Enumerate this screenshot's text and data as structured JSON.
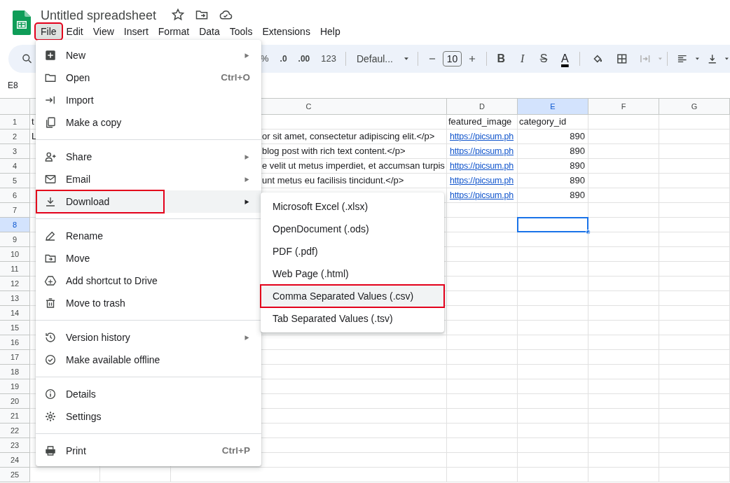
{
  "app": {
    "title": "Untitled spreadsheet"
  },
  "menubar": [
    {
      "label": "File",
      "selected": true,
      "annotated": true
    },
    {
      "label": "Edit",
      "selected": false,
      "annotated": false
    },
    {
      "label": "View",
      "selected": false,
      "annotated": false
    },
    {
      "label": "Insert",
      "selected": false,
      "annotated": false
    },
    {
      "label": "Format",
      "selected": false,
      "annotated": false
    },
    {
      "label": "Data",
      "selected": false,
      "annotated": false
    },
    {
      "label": "Tools",
      "selected": false,
      "annotated": false
    },
    {
      "label": "Extensions",
      "selected": false,
      "annotated": false
    },
    {
      "label": "Help",
      "selected": false,
      "annotated": false
    }
  ],
  "toolbar": {
    "number_formats": [
      "%",
      ".0",
      ".00",
      "123"
    ],
    "font": "Defaul...",
    "font_size": "10",
    "text_styles": [
      {
        "label": "B",
        "kind": "bold"
      },
      {
        "label": "I",
        "kind": "italic"
      },
      {
        "label": "S",
        "kind": "strike"
      },
      {
        "label": "A",
        "kind": "color"
      }
    ]
  },
  "name_box": "E8",
  "columns": [
    {
      "label": "C",
      "selected": false
    },
    {
      "label": "D",
      "selected": false
    },
    {
      "label": "E",
      "selected": true
    },
    {
      "label": "F",
      "selected": false
    },
    {
      "label": "G",
      "selected": false
    }
  ],
  "rows": [
    {
      "number": "1",
      "selected": false,
      "a": {
        "text": "t"
      },
      "d": {
        "text": "featured_image"
      },
      "e": {
        "text": "category_id"
      }
    },
    {
      "number": "2",
      "selected": false,
      "a": {
        "text": "L"
      },
      "c": {
        "text": "or sit amet, consectetur adipiscing elit.</p>"
      },
      "d": {
        "text": "https://picsum.ph",
        "kind": "link"
      },
      "e": {
        "text": "890",
        "kind": "number"
      }
    },
    {
      "number": "3",
      "selected": false,
      "c": {
        "text": "blog post with rich text content.</p>"
      },
      "d": {
        "text": "https://picsum.ph",
        "kind": "link"
      },
      "e": {
        "text": "890",
        "kind": "number"
      }
    },
    {
      "number": "4",
      "selected": false,
      "c": {
        "text": "e velit ut metus imperdiet, et accumsan turpis"
      },
      "d": {
        "text": "https://picsum.ph",
        "kind": "link"
      },
      "e": {
        "text": "890",
        "kind": "number"
      }
    },
    {
      "number": "5",
      "selected": false,
      "c": {
        "text": "unt metus eu facilisis tincidunt.</p>"
      },
      "d": {
        "text": "https://picsum.ph",
        "kind": "link"
      },
      "e": {
        "text": "890",
        "kind": "number"
      }
    },
    {
      "number": "6",
      "selected": false,
      "d": {
        "text": "https://picsum.ph",
        "kind": "link"
      },
      "e": {
        "text": "890",
        "kind": "number"
      }
    },
    {
      "number": "7",
      "selected": false
    },
    {
      "number": "8",
      "selected": true
    },
    {
      "number": "9",
      "selected": false
    },
    {
      "number": "10",
      "selected": false
    },
    {
      "number": "11",
      "selected": false
    },
    {
      "number": "12",
      "selected": false
    },
    {
      "number": "13",
      "selected": false
    },
    {
      "number": "14",
      "selected": false
    },
    {
      "number": "15",
      "selected": false
    },
    {
      "number": "16",
      "selected": false
    },
    {
      "number": "17",
      "selected": false
    },
    {
      "number": "18",
      "selected": false
    },
    {
      "number": "19",
      "selected": false
    },
    {
      "number": "20",
      "selected": false
    },
    {
      "number": "21",
      "selected": false
    },
    {
      "number": "22",
      "selected": false
    },
    {
      "number": "23",
      "selected": false
    },
    {
      "number": "24",
      "selected": false
    },
    {
      "number": "25",
      "selected": false
    }
  ],
  "file_menu": {
    "items": [
      {
        "kind": "item",
        "label": "New",
        "submenu": true,
        "selected": false,
        "annotated": false
      },
      {
        "kind": "item",
        "label": "Open",
        "shortcut": "Ctrl+O",
        "submenu": false,
        "selected": false,
        "annotated": false
      },
      {
        "kind": "item",
        "label": "Import",
        "submenu": false,
        "selected": false,
        "annotated": false
      },
      {
        "kind": "item",
        "label": "Make a copy",
        "submenu": false,
        "selected": false,
        "annotated": false
      },
      {
        "kind": "separator"
      },
      {
        "kind": "item",
        "label": "Share",
        "submenu": true,
        "selected": false,
        "annotated": false
      },
      {
        "kind": "item",
        "label": "Email",
        "submenu": true,
        "selected": false,
        "annotated": false
      },
      {
        "kind": "item",
        "label": "Download",
        "submenu": true,
        "selected": true,
        "annotated": true
      },
      {
        "kind": "separator"
      },
      {
        "kind": "item",
        "label": "Rename",
        "submenu": false,
        "selected": false,
        "annotated": false
      },
      {
        "kind": "item",
        "label": "Move",
        "submenu": false,
        "selected": false,
        "annotated": false
      },
      {
        "kind": "item",
        "label": "Add shortcut to Drive",
        "submenu": false,
        "selected": false,
        "annotated": false
      },
      {
        "kind": "item",
        "label": "Move to trash",
        "submenu": false,
        "selected": false,
        "annotated": false
      },
      {
        "kind": "separator"
      },
      {
        "kind": "item",
        "label": "Version history",
        "submenu": true,
        "selected": false,
        "annotated": false
      },
      {
        "kind": "item",
        "label": "Make available offline",
        "submenu": false,
        "selected": false,
        "annotated": false
      },
      {
        "kind": "separator"
      },
      {
        "kind": "item",
        "label": "Details",
        "submenu": false,
        "selected": false,
        "annotated": false
      },
      {
        "kind": "item",
        "label": "Settings",
        "submenu": false,
        "selected": false,
        "annotated": false
      },
      {
        "kind": "separator"
      },
      {
        "kind": "item",
        "label": "Print",
        "shortcut": "Ctrl+P",
        "submenu": false,
        "selected": false,
        "annotated": false
      }
    ]
  },
  "download_menu": {
    "items": [
      {
        "label": "Microsoft Excel (.xlsx)",
        "selected": false,
        "annotated": false
      },
      {
        "label": "OpenDocument (.ods)",
        "selected": false,
        "annotated": false
      },
      {
        "label": "PDF (.pdf)",
        "selected": false,
        "annotated": false
      },
      {
        "label": "Web Page (.html)",
        "selected": false,
        "annotated": false
      },
      {
        "label": "Comma Separated Values (.csv)",
        "selected": true,
        "annotated": true
      },
      {
        "label": "Tab Separated Values (.tsv)",
        "selected": false,
        "annotated": false
      }
    ]
  }
}
